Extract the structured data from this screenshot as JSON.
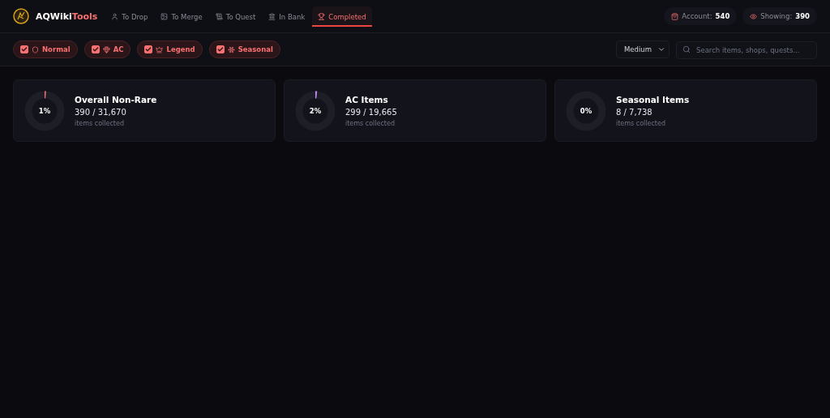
{
  "brand": {
    "name": "AQWiki",
    "accent": "Tools"
  },
  "tabs": [
    {
      "label": "To Drop",
      "selected": false
    },
    {
      "label": "To Merge",
      "selected": false
    },
    {
      "label": "To Quest",
      "selected": false
    },
    {
      "label": "In Bank",
      "selected": false
    },
    {
      "label": "Completed",
      "selected": true
    }
  ],
  "counters": [
    {
      "label": "Account:",
      "value": "540"
    },
    {
      "label": "Showing:",
      "value": "390"
    }
  ],
  "filters": [
    {
      "label": "Normal",
      "checked": true
    },
    {
      "label": "AC",
      "checked": true
    },
    {
      "label": "Legend",
      "checked": true
    },
    {
      "label": "Seasonal",
      "checked": true
    }
  ],
  "size_select": {
    "value": "Medium"
  },
  "search": {
    "placeholder": "Search items, shops, quests..."
  },
  "stats": [
    {
      "title": "Overall Non-Rare",
      "percent": "1%",
      "count": "390 / 31,670",
      "caption": "items collected",
      "level": 0.012,
      "color": "#f87171"
    },
    {
      "title": "AC Items",
      "percent": "2%",
      "count": "299 / 19,665",
      "caption": "items collected",
      "level": 0.015,
      "color": "#c084fc"
    },
    {
      "title": "Seasonal Items",
      "percent": "0%",
      "count": "8 / 7,738",
      "caption": "items collected",
      "level": 0
    }
  ]
}
